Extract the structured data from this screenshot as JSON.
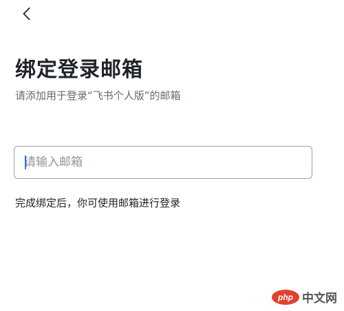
{
  "header": {
    "back_icon": "chevron-left-icon"
  },
  "main": {
    "title": "绑定登录邮箱",
    "subtitle": "请添加用于登录“飞书个人版”的邮箱",
    "email_input": {
      "value": "",
      "placeholder": "请输入邮箱"
    },
    "hint": "完成绑定后，你可使用邮箱进行登录"
  },
  "watermark": {
    "logo_text": "php",
    "site_text": "中文网"
  },
  "colors": {
    "text_primary": "#1f2329",
    "text_secondary": "#646a73",
    "input_border": "#9aa0a8",
    "caret": "#3370ff",
    "watermark_logo": "#e3402f"
  }
}
